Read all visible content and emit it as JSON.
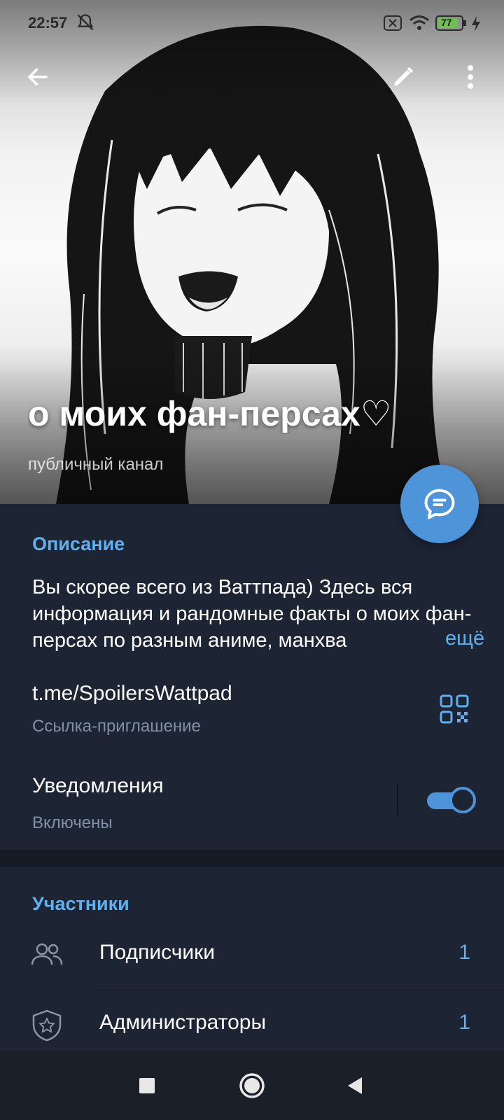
{
  "status": {
    "time": "22:57",
    "battery": "77"
  },
  "channel": {
    "title": "о моих фан-персах♡",
    "subtitle": "публичный канал"
  },
  "info": {
    "description_title": "Описание",
    "description": "Вы скорее всего из Ваттпада) Здесь вся информация и рандомные факты о моих фан-персах по разным аниме, манхва",
    "more_label": "ещё",
    "link": "t.me/SpoilersWattpad",
    "link_caption": "Ссылка-приглашение",
    "notifications_label": "Уведомления",
    "notifications_state": "Включены",
    "notifications_on": true
  },
  "members": {
    "title": "Участники",
    "rows": [
      {
        "label": "Подписчики",
        "count": "1",
        "icon": "people-icon"
      },
      {
        "label": "Администраторы",
        "count": "1",
        "icon": "admin-shield-icon"
      }
    ]
  },
  "colors": {
    "accent": "#5fb0f0",
    "fab": "#4d94d9",
    "background": "#1d2433"
  }
}
